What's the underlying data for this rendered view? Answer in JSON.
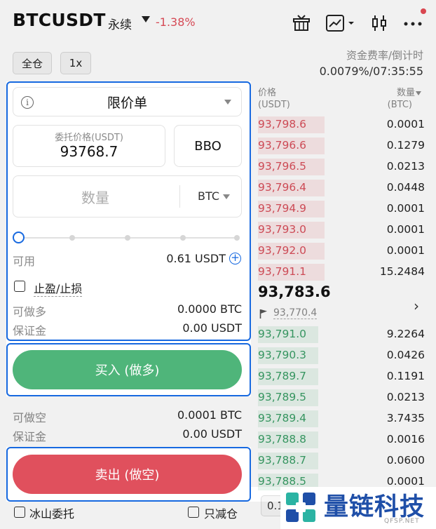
{
  "header": {
    "symbol": "BTCUSDT",
    "contract_type": "永续",
    "change": "-1.38%",
    "icons": [
      "gift-icon",
      "chart-icon",
      "candlestick-icon",
      "more-icon"
    ]
  },
  "controls": {
    "margin_mode": "全仓",
    "leverage": "1x"
  },
  "funding": {
    "label": "资金费率/倒计时",
    "value": "0.0079%/07:35:55"
  },
  "order_form": {
    "order_type": "限价单",
    "price_label": "委托价格(USDT)",
    "price_value": "93768.7",
    "bbo_label": "BBO",
    "qty_placeholder": "数量",
    "qty_unit": "BTC",
    "slider_level_pct": 0,
    "available_label": "可用",
    "available_value": "0.61 USDT",
    "tpsl_label": "止盈/止损",
    "long_max_label": "可做多",
    "long_max_value": "0.0000 BTC",
    "long_margin_label": "保证金",
    "long_margin_value": "0.00 USDT",
    "buy_label": "买入 (做多)",
    "short_max_label": "可做空",
    "short_max_value": "0.0001 BTC",
    "short_margin_label": "保证金",
    "short_margin_value": "0.00 USDT",
    "sell_label": "卖出 (做空)",
    "iceberg_label": "冰山委托",
    "reduce_only_label": "只减仓"
  },
  "orderbook": {
    "price_header": "价格",
    "price_unit": "(USDT)",
    "qty_header": "数量",
    "qty_unit": "(BTC)",
    "asks": [
      {
        "price": "93,798.6",
        "qty": "0.0001",
        "depth": 0.4
      },
      {
        "price": "93,796.6",
        "qty": "0.1279",
        "depth": 0.4
      },
      {
        "price": "93,796.5",
        "qty": "0.0213",
        "depth": 0.4
      },
      {
        "price": "93,796.4",
        "qty": "0.0448",
        "depth": 0.4
      },
      {
        "price": "93,794.9",
        "qty": "0.0001",
        "depth": 0.4
      },
      {
        "price": "93,793.0",
        "qty": "0.0001",
        "depth": 0.4
      },
      {
        "price": "93,792.0",
        "qty": "0.0001",
        "depth": 0.4
      },
      {
        "price": "93,791.1",
        "qty": "15.2484",
        "depth": 0.4
      }
    ],
    "last_price": "93,783.6",
    "index_price": "93,770.4",
    "bids": [
      {
        "price": "93,791.0",
        "qty": "9.2264",
        "depth": 0.36
      },
      {
        "price": "93,790.3",
        "qty": "0.0426",
        "depth": 0.36
      },
      {
        "price": "93,789.7",
        "qty": "0.1191",
        "depth": 0.36
      },
      {
        "price": "93,789.5",
        "qty": "0.0213",
        "depth": 0.36
      },
      {
        "price": "93,789.4",
        "qty": "3.7435",
        "depth": 0.36
      },
      {
        "price": "93,788.8",
        "qty": "0.0016",
        "depth": 0.36
      },
      {
        "price": "93,788.7",
        "qty": "0.0600",
        "depth": 0.36
      },
      {
        "price": "93,788.5",
        "qty": "0.0001",
        "depth": 0.36
      }
    ],
    "depth_step": "0.1"
  },
  "watermark": {
    "text": "量链科技",
    "sub": "QFSP.NET"
  },
  "colors": {
    "accent": "#1769e0",
    "buy": "#4fb57a",
    "sell": "#e0505d",
    "ask_text": "#d9505b",
    "bid_text": "#3a9e66"
  }
}
